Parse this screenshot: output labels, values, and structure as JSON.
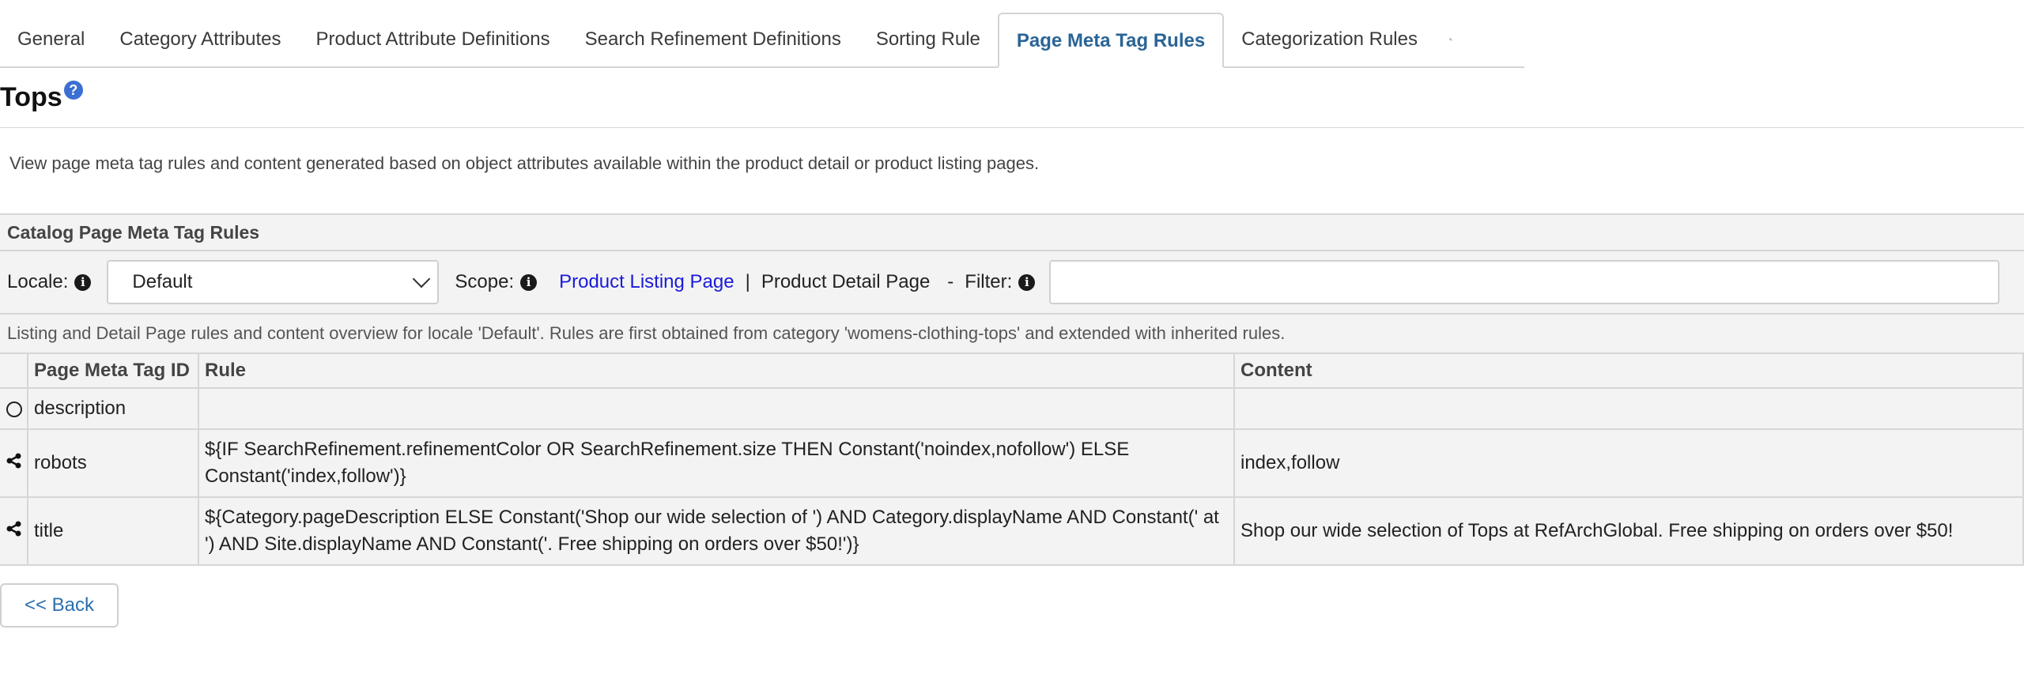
{
  "tabs": [
    {
      "label": "General"
    },
    {
      "label": "Category Attributes"
    },
    {
      "label": "Product Attribute Definitions"
    },
    {
      "label": "Search Refinement Definitions"
    },
    {
      "label": "Sorting Rule"
    },
    {
      "label": "Page Meta Tag Rules",
      "active": true
    },
    {
      "label": "Categorization Rules"
    }
  ],
  "page": {
    "title": "Tops",
    "help_glyph": "?",
    "intro": "View page meta tag rules and content generated based on object attributes available within the product detail or product listing pages."
  },
  "panel": {
    "header": "Catalog Page Meta Tag Rules",
    "locale_label": "Locale:",
    "locale_value": "Default",
    "scope_label": "Scope:",
    "scope_listing": "Product Listing Page",
    "scope_separator": "|",
    "scope_detail": "Product Detail Page",
    "filter_dash": "-",
    "filter_label": "Filter:",
    "filter_value": "",
    "info_glyph": "i",
    "overview": "Listing and Detail Page rules and content overview for locale 'Default'. Rules are first obtained from category 'womens-clothing-tops' and extended with inherited rules."
  },
  "table": {
    "headers": [
      "",
      "Page Meta Tag ID",
      "Rule",
      "Content"
    ],
    "rows": [
      {
        "icon": "radio-icon",
        "id": "description",
        "rule": "",
        "content": ""
      },
      {
        "icon": "share-icon",
        "id": "robots",
        "rule": "${IF SearchRefinement.refinementColor OR SearchRefinement.size THEN Constant('noindex,nofollow') ELSE Constant('index,follow')}",
        "content": "index,follow"
      },
      {
        "icon": "share-icon",
        "id": "title",
        "rule": "${Category.pageDescription ELSE Constant('Shop our wide selection of ') AND Category.displayName AND Constant(' at ') AND Site.displayName AND Constant('. Free shipping on orders over $50!')}",
        "content": "Shop our wide selection of Tops at RefArchGlobal. Free shipping on orders over $50!"
      }
    ]
  },
  "back_button": "<< Back",
  "colors": {
    "active_tab": "#2a6496",
    "link": "#1a1adb",
    "help": "#3b6fd4",
    "back": "#2a6fb0"
  }
}
